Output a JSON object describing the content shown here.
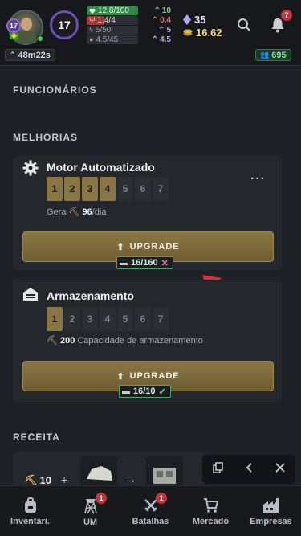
{
  "header": {
    "avatar_level": "17",
    "player_level": "17",
    "stats": [
      {
        "left": "12.8/100",
        "left_icon": "heart-icon",
        "left_color": "#2f8a46",
        "right": "10",
        "right_icon": "chevrons-up-icon",
        "right_color": "#7fd18f"
      },
      {
        "left": "1.4/4",
        "left_icon": "fork-knife-icon",
        "left_color": "#a03a3a",
        "right": "0.4",
        "right_icon": "chevrons-up-icon",
        "right_color": "#e07c7c"
      },
      {
        "left": "5/50",
        "left_icon": "lightning-icon",
        "left_color": "#2c3036",
        "right": "5",
        "right_icon": "chevrons-up-icon",
        "right_color": "#b9a6e8"
      },
      {
        "left": "4.5/45",
        "left_icon": "bulb-icon",
        "left_color": "#2c3036",
        "right": "4.5",
        "right_icon": "chevrons-up-icon",
        "right_color": "#b9a6e8"
      }
    ],
    "diamonds": "35",
    "coins": "16.62",
    "notifications": "7",
    "timer": "48m22s",
    "online": "695"
  },
  "sections": {
    "employees": "FUNCIONÁRIOS",
    "improvements": "MELHORIAS",
    "recipe": "RECEITA"
  },
  "motor": {
    "title": "Motor Automatizado",
    "levels": [
      "1",
      "2",
      "3",
      "4",
      "5",
      "6",
      "7"
    ],
    "level": 4,
    "gen_prefix": "Gera",
    "gen_value": "96",
    "gen_suffix": "/dia",
    "upgrade_label": "UPGRADE",
    "cost": "16/160",
    "cost_ok": false
  },
  "storage": {
    "title": "Armazenamento",
    "levels": [
      "1",
      "2",
      "3",
      "4",
      "5",
      "6",
      "7"
    ],
    "level": 1,
    "cap_value": "200",
    "cap_label": "Capacidade de armazenamento",
    "upgrade_label": "UPGRADE",
    "cost": "16/10",
    "cost_ok": true
  },
  "recipe": {
    "amount": "10",
    "plus": "+",
    "arrow": "→"
  },
  "nav": [
    {
      "label": "Inventári.",
      "icon": "backpack-icon",
      "badge": ""
    },
    {
      "label": "UM",
      "icon": "tower-icon",
      "badge": "1"
    },
    {
      "label": "Batalhas",
      "icon": "crossed-swords-icon",
      "badge": "1"
    },
    {
      "label": "Mercado",
      "icon": "cart-icon",
      "badge": ""
    },
    {
      "label": "Empresas",
      "icon": "factory-icon",
      "badge": ""
    }
  ],
  "colors": {
    "accent_gold": "#8a7544",
    "purple": "#6e4fb8",
    "green": "#3ccf6b",
    "alert_red": "#e52b2b"
  }
}
